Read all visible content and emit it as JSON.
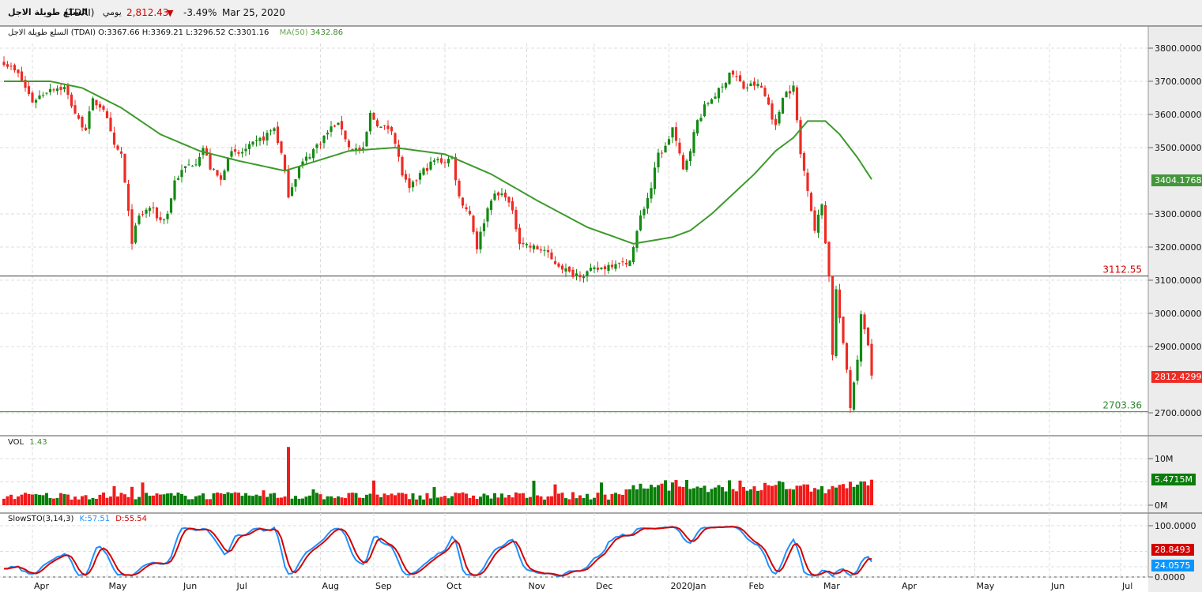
{
  "header": {
    "name": "السلع طويلة الاجل",
    "symbol": "(TDAI)",
    "period": "يومي",
    "last_price": "2,812.43",
    "change_pct": "-3.49%",
    "date": "Mar 25, 2020"
  },
  "ohlc_legend": {
    "name": "السلع طويلة الاجل (TDAI)",
    "open": "O:3367.66",
    "high": "H:3369.21",
    "low": "L:3296.52",
    "close": "C:3301.16",
    "ma_label": "MA(50)",
    "ma_value": "3432.86"
  },
  "volume_legend": {
    "label": "VOL",
    "value": "1.43"
  },
  "stoch_legend": {
    "label": "SlowSTO(3,14,3)",
    "k": "K:57.51",
    "d": "D:55.54"
  },
  "colors": {
    "up": "#138a13",
    "down": "#ee2b24",
    "ma": "#3d9a2c",
    "k": "#1e90ff",
    "d": "#d40000"
  },
  "chart_data": {
    "type": "candlestick",
    "title": "السلع طويلة الاجل (TDAI) يومي",
    "price_axis": {
      "ticks": [
        "3800.0000",
        "3700.0000",
        "3600.0000",
        "3500.0000",
        "3300.0000",
        "3200.0000",
        "3100.0000",
        "3000.0000",
        "2900.0000",
        "2700.0000"
      ],
      "tick_values": [
        3800,
        3700,
        3600,
        3500,
        3300,
        3200,
        3100,
        3000,
        2900,
        2700
      ],
      "range": [
        2640,
        3860
      ]
    },
    "time_axis": {
      "labels": [
        "Apr",
        "May",
        "Jun",
        "Jul",
        "Aug",
        "Sep",
        "Oct",
        "Nov",
        "Dec",
        "2020Jan",
        "Feb",
        "Mar",
        "Apr",
        "May",
        "Jun",
        "Jul"
      ],
      "label_candle_index": [
        8,
        29,
        50,
        65,
        89,
        104,
        124,
        147,
        166,
        187,
        209,
        230,
        252,
        273,
        294,
        314
      ]
    },
    "candle_count": 245,
    "close_keypoints": [
      [
        0,
        3760
      ],
      [
        4,
        3720
      ],
      [
        8,
        3640
      ],
      [
        13,
        3680
      ],
      [
        17,
        3680
      ],
      [
        21,
        3580
      ],
      [
        23,
        3560
      ],
      [
        25,
        3640
      ],
      [
        28,
        3620
      ],
      [
        31,
        3500
      ],
      [
        33,
        3480
      ],
      [
        35,
        3300
      ],
      [
        36,
        3220
      ],
      [
        38,
        3290
      ],
      [
        41,
        3320
      ],
      [
        44,
        3280
      ],
      [
        46,
        3300
      ],
      [
        48,
        3400
      ],
      [
        51,
        3440
      ],
      [
        54,
        3460
      ],
      [
        56,
        3500
      ],
      [
        58,
        3440
      ],
      [
        61,
        3400
      ],
      [
        63,
        3480
      ],
      [
        66,
        3480
      ],
      [
        69,
        3500
      ],
      [
        73,
        3530
      ],
      [
        76,
        3560
      ],
      [
        78,
        3480
      ],
      [
        80,
        3360
      ],
      [
        83,
        3440
      ],
      [
        86,
        3480
      ],
      [
        89,
        3520
      ],
      [
        93,
        3570
      ],
      [
        95,
        3560
      ],
      [
        97,
        3500
      ],
      [
        101,
        3490
      ],
      [
        103,
        3600
      ],
      [
        106,
        3560
      ],
      [
        109,
        3560
      ],
      [
        112,
        3420
      ],
      [
        114,
        3370
      ],
      [
        117,
        3420
      ],
      [
        121,
        3460
      ],
      [
        124,
        3460
      ],
      [
        126,
        3470
      ],
      [
        128,
        3350
      ],
      [
        131,
        3300
      ],
      [
        133,
        3200
      ],
      [
        135,
        3280
      ],
      [
        137,
        3350
      ],
      [
        141,
        3360
      ],
      [
        143,
        3300
      ],
      [
        145,
        3220
      ],
      [
        148,
        3200
      ],
      [
        152,
        3190
      ],
      [
        154,
        3160
      ],
      [
        157,
        3140
      ],
      [
        159,
        3120
      ],
      [
        163,
        3120
      ],
      [
        166,
        3130
      ],
      [
        169,
        3140
      ],
      [
        173,
        3160
      ],
      [
        175,
        3140
      ],
      [
        177,
        3200
      ],
      [
        179,
        3290
      ],
      [
        182,
        3380
      ],
      [
        184,
        3480
      ],
      [
        186,
        3500
      ],
      [
        188,
        3560
      ],
      [
        191,
        3430
      ],
      [
        193,
        3500
      ],
      [
        195,
        3580
      ],
      [
        197,
        3620
      ],
      [
        199,
        3650
      ],
      [
        202,
        3680
      ],
      [
        204,
        3730
      ],
      [
        206,
        3710
      ],
      [
        208,
        3680
      ],
      [
        211,
        3690
      ],
      [
        213,
        3680
      ],
      [
        215,
        3630
      ],
      [
        217,
        3560
      ],
      [
        219,
        3660
      ],
      [
        222,
        3680
      ],
      [
        224,
        3480
      ],
      [
        226,
        3380
      ],
      [
        228,
        3250
      ],
      [
        230,
        3330
      ],
      [
        232,
        3110
      ],
      [
        233,
        2880
      ],
      [
        234,
        3070
      ],
      [
        236,
        2900
      ],
      [
        237,
        2830
      ],
      [
        238,
        2720
      ],
      [
        240,
        2870
      ],
      [
        241,
        2990
      ],
      [
        242,
        2960
      ],
      [
        243,
        2900
      ],
      [
        244,
        2812.43
      ]
    ],
    "ma50_keypoints": [
      [
        0,
        3700
      ],
      [
        13,
        3700
      ],
      [
        22,
        3680
      ],
      [
        33,
        3620
      ],
      [
        44,
        3540
      ],
      [
        55,
        3490
      ],
      [
        66,
        3460
      ],
      [
        79,
        3430
      ],
      [
        88,
        3460
      ],
      [
        97,
        3490
      ],
      [
        110,
        3500
      ],
      [
        124,
        3480
      ],
      [
        137,
        3420
      ],
      [
        150,
        3340
      ],
      [
        164,
        3260
      ],
      [
        177,
        3210
      ],
      [
        188,
        3230
      ],
      [
        193,
        3250
      ],
      [
        199,
        3300
      ],
      [
        211,
        3420
      ],
      [
        217,
        3490
      ],
      [
        222,
        3530
      ],
      [
        226,
        3580
      ],
      [
        231,
        3580
      ],
      [
        235,
        3540
      ],
      [
        240,
        3470
      ],
      [
        244,
        3404.1768
      ]
    ],
    "horizontal_lines": [
      {
        "label": "3112.55",
        "value": 3112.55,
        "color": "#444444",
        "label_color": "#d40000"
      },
      {
        "label": "2703.36",
        "value": 2703.36,
        "color": "#2e8b2e",
        "label_color": "#2e8b2e"
      }
    ],
    "current_tags": {
      "ma": "3404.1768",
      "price": "2812.4299"
    },
    "volume_axis": {
      "ticks": [
        "10M",
        "0M"
      ],
      "tick_values": [
        10,
        0
      ],
      "current": "5.4715M",
      "current_value": 5.4715
    },
    "stoch_axis": {
      "ticks": [
        "100.0000",
        "0.0000"
      ],
      "tick_values": [
        100,
        0
      ],
      "d_current": "28.8493",
      "k_current": "24.0575"
    }
  }
}
